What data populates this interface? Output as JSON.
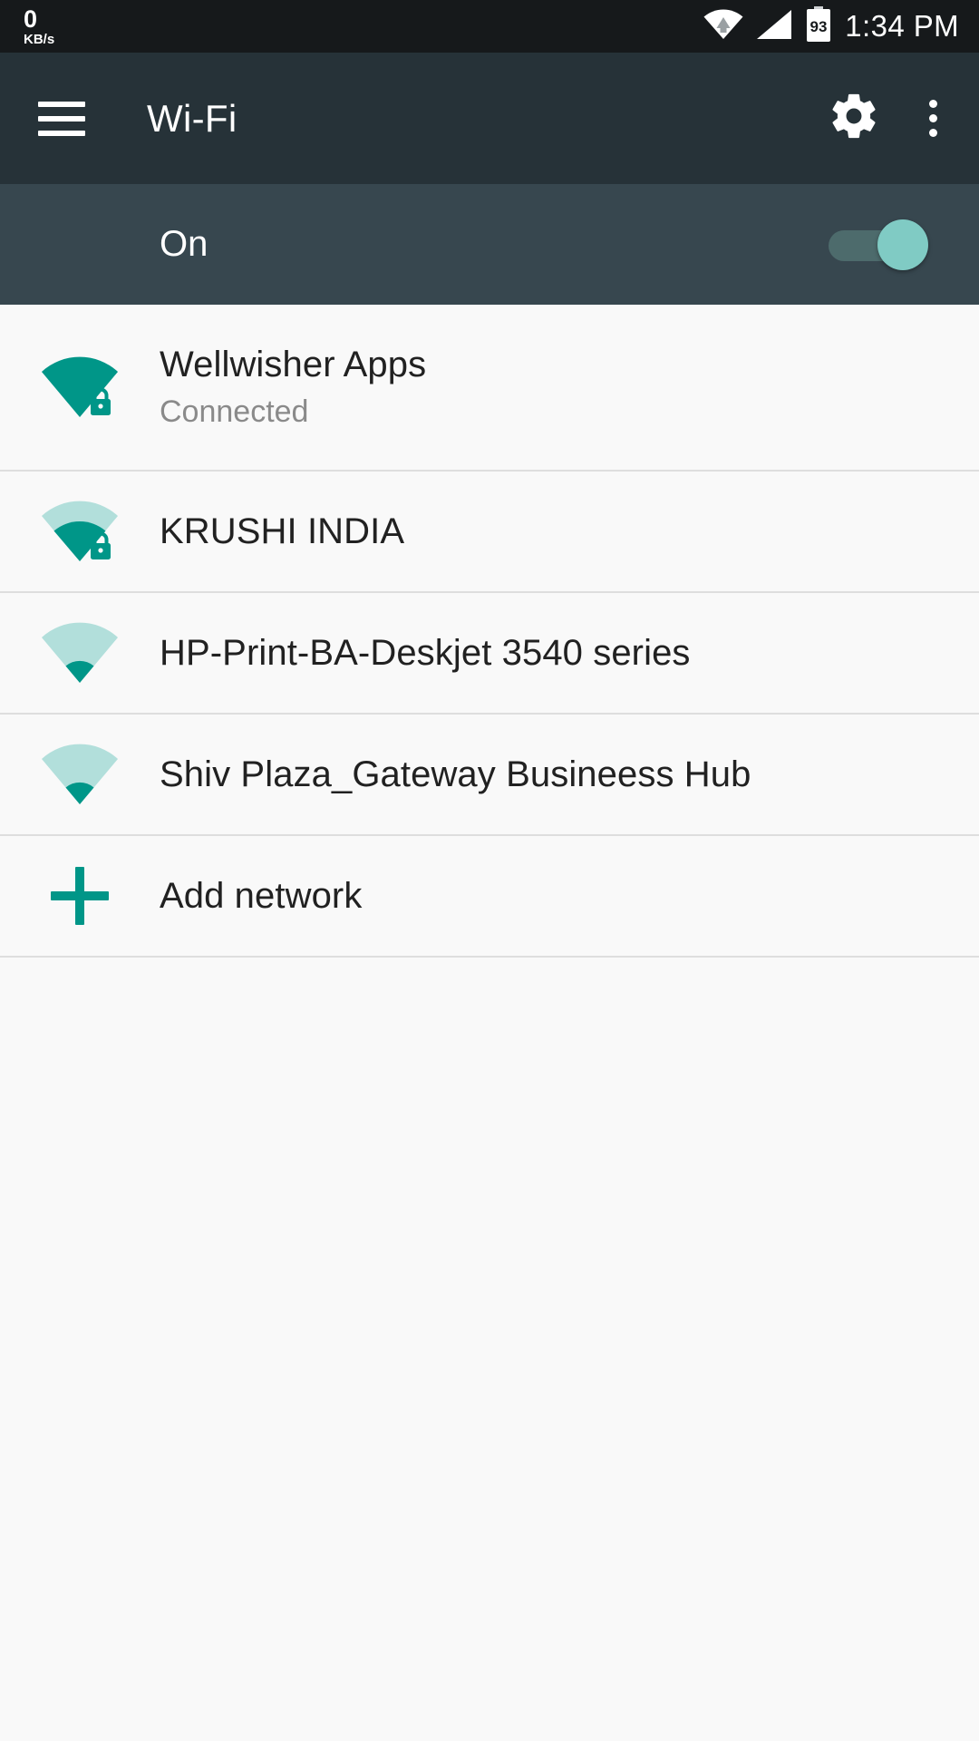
{
  "status_bar": {
    "net_speed_value": "0",
    "net_speed_unit": "KB/s",
    "wifi_icon": "wifi-signal-icon",
    "cell_icon": "cellular-signal-icon",
    "battery_level": "93",
    "time": "1:34 PM"
  },
  "app_bar": {
    "menu_icon": "hamburger-menu-icon",
    "title": "Wi-Fi",
    "settings_icon": "gear-icon",
    "overflow_icon": "more-vert-icon"
  },
  "wifi_toggle": {
    "label": "On",
    "state": "on",
    "thumb_color": "#80cbc4",
    "track_color": "#4d6b6c"
  },
  "networks": [
    {
      "ssid": "Wellwisher Apps",
      "status": "Connected",
      "signal_bars": 4,
      "secured": true,
      "icon": "wifi-signal-4-lock-icon"
    },
    {
      "ssid": "KRUSHI INDIA",
      "status": "",
      "signal_bars": 2,
      "secured": true,
      "icon": "wifi-signal-2-lock-icon"
    },
    {
      "ssid": "HP-Print-BA-Deskjet 3540 series",
      "status": "",
      "signal_bars": 1,
      "secured": false,
      "icon": "wifi-signal-1-icon"
    },
    {
      "ssid": "Shiv Plaza_Gateway Busineess Hub",
      "status": "",
      "signal_bars": 1,
      "secured": false,
      "icon": "wifi-signal-1-icon"
    }
  ],
  "add_network": {
    "label": "Add network",
    "icon": "plus-icon"
  },
  "colors": {
    "app_bar": "#263238",
    "toggle_bar": "#37474F",
    "status_bar": "#16191b",
    "accent_teal": "#009688",
    "accent_teal_light": "#b2dfdb",
    "list_background": "#f9f9f9",
    "divider": "#dedede",
    "primary_text": "#212121",
    "secondary_text": "#8a8a8a"
  }
}
